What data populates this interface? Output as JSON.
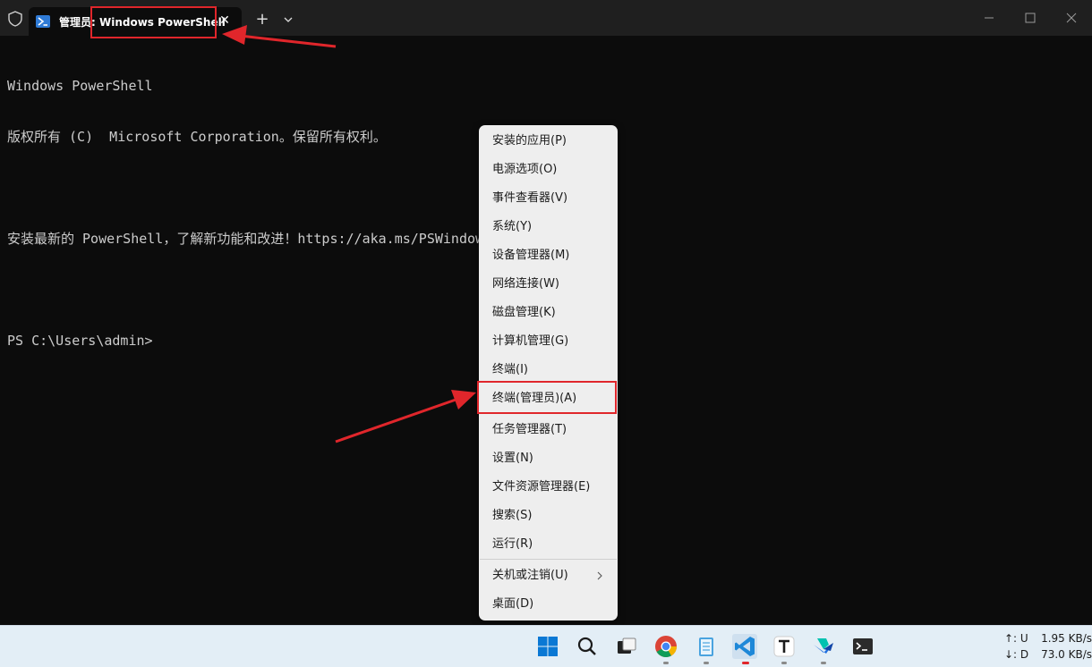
{
  "tab": {
    "title": "管理员: Windows PowerShell",
    "close_symbol": "✕",
    "new_tab_symbol": "+"
  },
  "console": {
    "lines": [
      "Windows PowerShell",
      "版权所有 (C)  Microsoft Corporation。保留所有权利。",
      "",
      "安装最新的 PowerShell，了解新功能和改进！https://aka.ms/PSWindows",
      "",
      "PS C:\\Users\\admin>"
    ]
  },
  "menu": {
    "items": [
      "安装的应用(P)",
      "电源选项(O)",
      "事件查看器(V)",
      "系统(Y)",
      "设备管理器(M)",
      "网络连接(W)",
      "磁盘管理(K)",
      "计算机管理(G)",
      "终端(I)",
      "终端(管理员)(A)",
      "任务管理器(T)",
      "设置(N)",
      "文件资源管理器(E)",
      "搜索(S)",
      "运行(R)",
      "关机或注销(U)",
      "桌面(D)"
    ]
  },
  "taskbar": {
    "icons": [
      "windows-start-icon",
      "search-icon",
      "task-view-icon",
      "chrome-icon",
      "notepad-icon",
      "vscode-icon",
      "typora-icon",
      "feishu-icon",
      "terminal-icon"
    ],
    "net": {
      "up_label": "↑: U",
      "up_value": "1.95 KB/s",
      "down_label": "↓: D",
      "down_value": "73.0 KB/s"
    }
  },
  "colors": {
    "annotation": "#e0262b",
    "console_bg": "#0c0c0c",
    "titlebar_bg": "#1f1f1f",
    "menu_bg": "#eeeeee",
    "taskbar_bg": "#e3eef6"
  }
}
